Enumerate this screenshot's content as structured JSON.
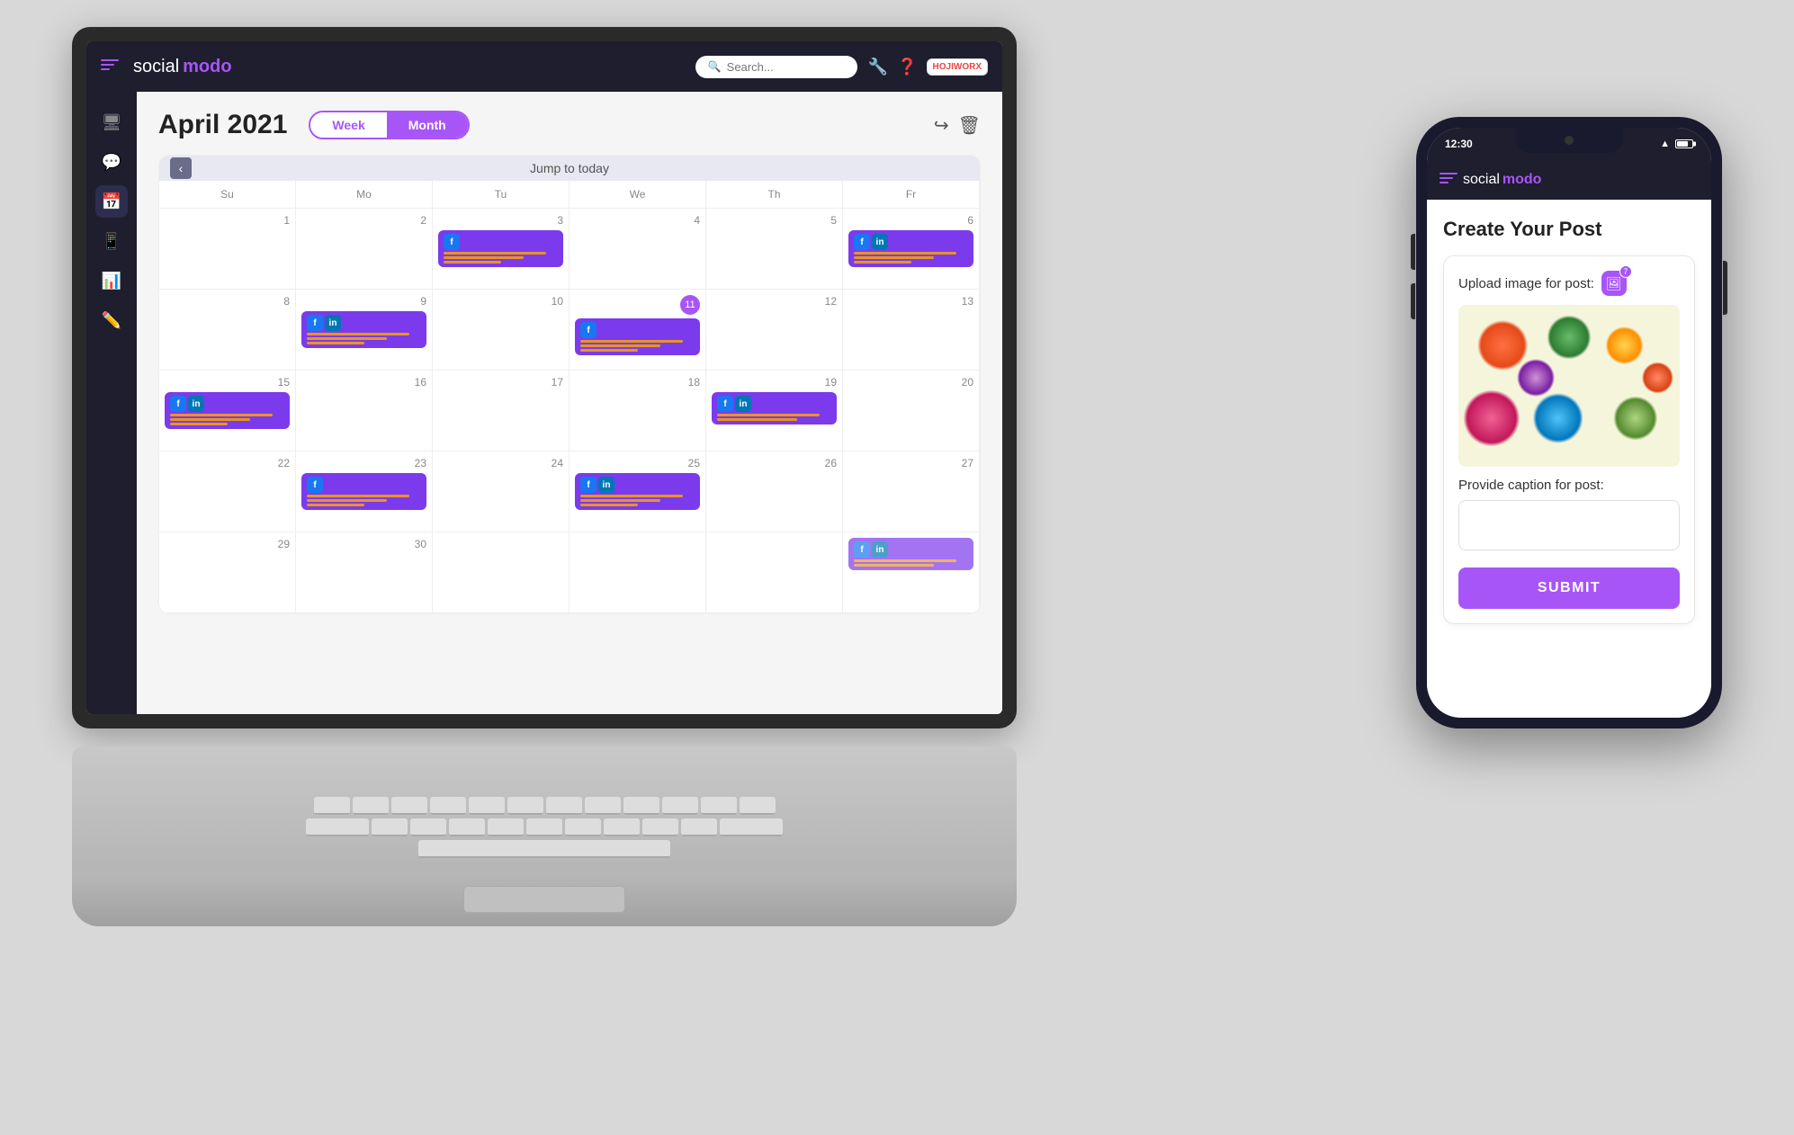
{
  "app": {
    "name_social": "social",
    "name_modo": "modo",
    "logo_icon": "menu"
  },
  "laptop": {
    "topbar": {
      "search_placeholder": "Search...",
      "hojiworx_label": "HOJIWORX"
    },
    "sidebar": {
      "items": [
        {
          "label": "monitor",
          "icon": "🖥",
          "active": false
        },
        {
          "label": "chat",
          "icon": "💬",
          "active": false
        },
        {
          "label": "calendar",
          "icon": "📅",
          "active": true
        },
        {
          "label": "mobile",
          "icon": "📱",
          "active": false
        },
        {
          "label": "chart",
          "icon": "📊",
          "active": false
        },
        {
          "label": "edit",
          "icon": "✏️",
          "active": false
        }
      ]
    },
    "calendar": {
      "title": "April 2021",
      "view_week": "Week",
      "view_month": "Month",
      "nav_label": "Jump to today",
      "day_headers": [
        "Su",
        "Mo",
        "Tu",
        "We",
        "Th",
        "Fr"
      ],
      "toolbar_share": "share",
      "toolbar_delete": "delete",
      "weeks": [
        [
          {
            "date": "",
            "events": []
          },
          {
            "date": "",
            "events": []
          },
          {
            "date": "3",
            "events": [
              {
                "type": "fb",
                "lines": 3
              }
            ]
          },
          {
            "date": "4",
            "events": []
          },
          {
            "date": "5",
            "events": []
          },
          {
            "date": "6",
            "events": [
              {
                "type": "fb_li",
                "lines": 3
              }
            ]
          }
        ],
        [
          {
            "date": "8",
            "events": []
          },
          {
            "date": "9",
            "events": [
              {
                "type": "fb_li",
                "lines": 3
              }
            ]
          },
          {
            "date": "10",
            "events": []
          },
          {
            "date": "11",
            "events": [
              {
                "type": "fb",
                "lines": 3
              }
            ],
            "highlight": true
          },
          {
            "date": "12",
            "events": []
          },
          {
            "date": "13",
            "events": []
          }
        ],
        [
          {
            "date": "15",
            "events": [
              {
                "type": "fb_li",
                "lines": 3
              }
            ]
          },
          {
            "date": "16",
            "events": []
          },
          {
            "date": "17",
            "events": []
          },
          {
            "date": "18",
            "events": []
          },
          {
            "date": "19",
            "events": [
              {
                "type": "fb_li",
                "lines": 2
              }
            ]
          },
          {
            "date": "20",
            "events": []
          }
        ],
        [
          {
            "date": "22",
            "events": []
          },
          {
            "date": "23",
            "events": [
              {
                "type": "fb",
                "lines": 3
              }
            ]
          },
          {
            "date": "24",
            "events": []
          },
          {
            "date": "25",
            "events": [
              {
                "type": "fb_li",
                "lines": 3
              }
            ]
          },
          {
            "date": "26",
            "events": []
          },
          {
            "date": "27",
            "events": []
          }
        ],
        [
          {
            "date": "29",
            "events": []
          },
          {
            "date": "30",
            "events": []
          },
          {
            "date": "",
            "events": []
          },
          {
            "date": "",
            "events": []
          },
          {
            "date": "",
            "events": []
          },
          {
            "date": "",
            "events": [
              {
                "type": "fb_li_partial",
                "lines": 2
              }
            ]
          }
        ]
      ]
    }
  },
  "phone": {
    "time": "12:30",
    "topbar": {
      "name_social": "social",
      "name_modo": "modo"
    },
    "create_post": {
      "title": "Create Your Post",
      "upload_label": "Upload image for post:",
      "upload_count": "7",
      "caption_label": "Provide caption for post:",
      "caption_placeholder": "",
      "submit_label": "SUBMIT"
    }
  }
}
